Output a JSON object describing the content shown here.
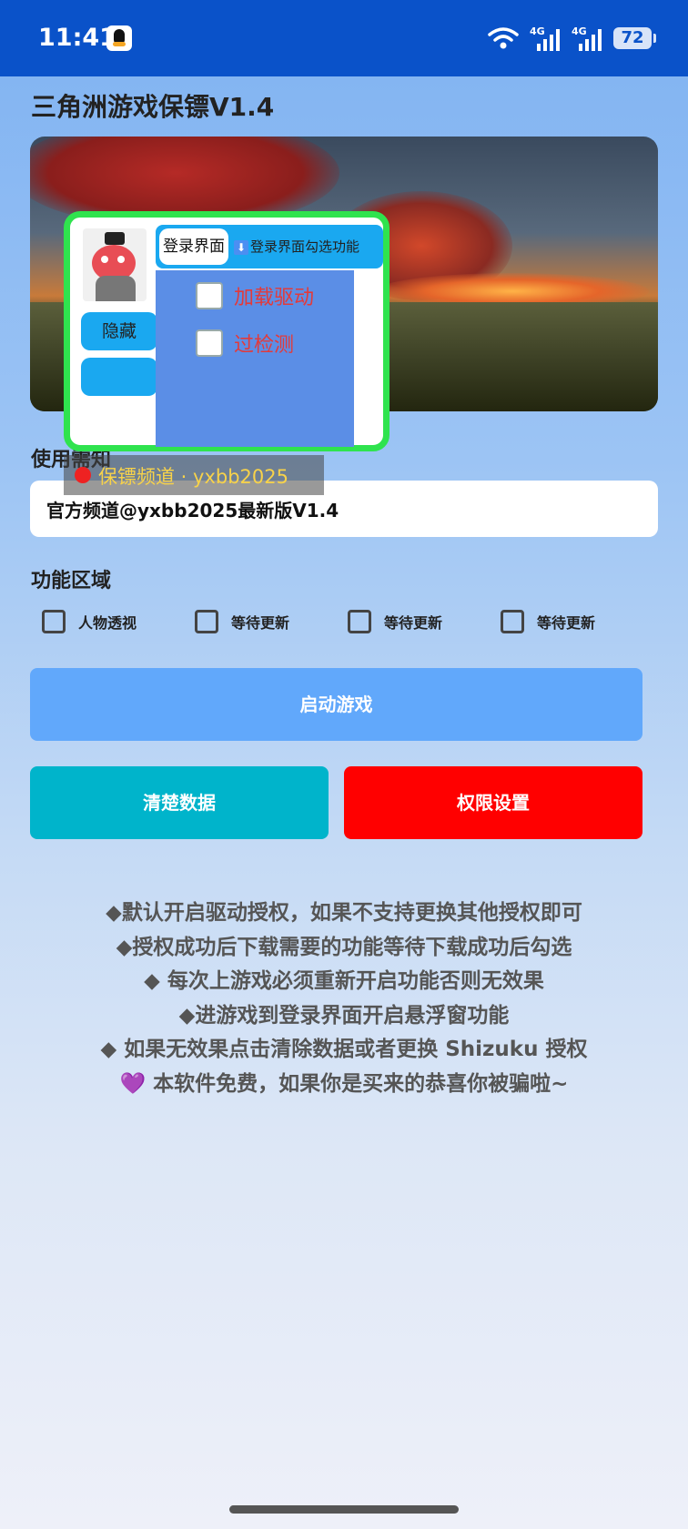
{
  "status_bar": {
    "time": "11:41",
    "network_1": "4G",
    "network_2": "4G",
    "battery": "72"
  },
  "app": {
    "title": "三角洲游戏保镖V1.4"
  },
  "overlay": {
    "hide_label": "隐藏",
    "tab_label": "登录界面",
    "hint": "登录界面勾选功能",
    "options": [
      "加载驱动",
      "过检测"
    ],
    "channel": "保镖频道 · yxbb2025"
  },
  "usage": {
    "label": "使用需知",
    "notice": "官方频道@yxbb2025最新版V1.4"
  },
  "functions": {
    "label": "功能区域",
    "items": [
      "人物透视",
      "等待更新",
      "等待更新",
      "等待更新"
    ]
  },
  "buttons": {
    "start": "启动游戏",
    "clear": "清楚数据",
    "permission": "权限设置"
  },
  "instructions": [
    "◆默认开启驱动授权，如果不支持更换其他授权即可",
    "◆授权成功后下载需要的功能等待下载成功后勾选",
    "◆ 每次上游戏必须重新开启功能否则无效果",
    "◆进游戏到登录界面开启悬浮窗功能",
    "◆ 如果无效果点击清除数据或者更换 Shizuku 授权",
    "💜 本软件免费，如果你是买来的恭喜你被骗啦~"
  ],
  "colors": {
    "status_bar": "#0a52c9",
    "start_button": "#61a8fb",
    "clear_button": "#00b4cb",
    "permission_button": "#ff0000",
    "overlay_border": "#2fe34e"
  }
}
